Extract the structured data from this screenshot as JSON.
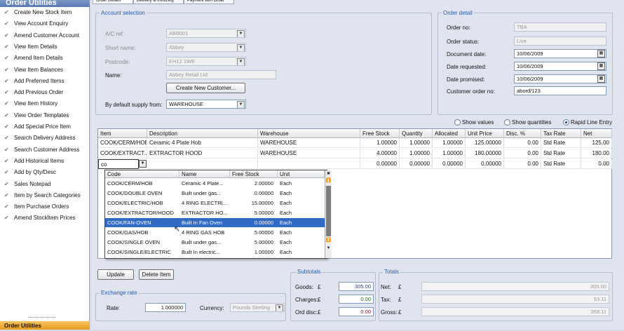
{
  "sidebar": {
    "title": "Order Utilities",
    "items": [
      "Create New Stock Item",
      "View Account Enquiry",
      "Amend Customer Account",
      "View Item Details",
      "Amend Item Details",
      "View Item Balances",
      "Add Preferred Items",
      "Add Previous Order",
      "View Item History",
      "View Order Templates",
      "Add Special Price Item",
      "Search Delivery Address",
      "Search Customer Address",
      "Add Historical Items",
      "Add by Qty/Desc",
      "Sales Notepad",
      "Item by Search Categories",
      "Item Purchase Orders",
      "Amend StockItem Prices"
    ],
    "footer": "Order Utilities"
  },
  "tabs": [
    "Order Details",
    "Delivery & Invoicing",
    "Payment with Order"
  ],
  "account": {
    "title": "Account selection",
    "ac_ref_label": "A/C ref:",
    "ac_ref": "ABB001",
    "short_name_label": "Short name:",
    "short_name": "Abbey",
    "postcode_label": "Postcode:",
    "postcode": "EH12 1WE",
    "name_label": "Name:",
    "name": "Abbey Retail Ltd",
    "create_button": "Create New Customer...",
    "supply_label": "By default supply from:",
    "supply": "WAREHOUSE"
  },
  "order": {
    "title": "Order detail",
    "order_no_label": "Order no:",
    "order_no": "TBA",
    "status_label": "Order status:",
    "status": "Live",
    "doc_date_label": "Document date:",
    "doc_date": "10/06/2009",
    "req_label": "Date requested:",
    "req_date": "10/06/2009",
    "prom_label": "Date promised:",
    "prom_date": "10/06/2009",
    "cust_order_label": "Customer order no:",
    "cust_order": "abord/123"
  },
  "radios": {
    "values": "Show values",
    "quantities": "Show quantities",
    "rapid": "Rapid Line Entry"
  },
  "grid": {
    "headers": [
      "Item",
      "Description",
      "Warehouse",
      "Free Stock",
      "Quantity",
      "Allocated",
      "Unit Price",
      "Disc. %",
      "Tax Rate",
      "Net"
    ],
    "rows": [
      [
        "COOK/CERM/HOB",
        "Ceramic 4 Plate Hob",
        "WAREHOUSE",
        "1.00000",
        "1.00000",
        "1.00000",
        "125.00000",
        "0.00",
        "Std Rate",
        "125.00"
      ],
      [
        "COOK/EXTRACT...",
        "EXTRACTOR HOOD",
        "WAREHOUSE",
        "4.00000",
        "1.00000",
        "1.00000",
        "180.00000",
        "0.00",
        "Std Rate",
        "180.00"
      ],
      [
        "co",
        "",
        "",
        "0.00000",
        "0.00000",
        "0.00000",
        "0.00000",
        "0.00",
        "Std Rate",
        "0.00"
      ]
    ]
  },
  "popup": {
    "headers": [
      "Code",
      "Name",
      "Free Stock",
      "Unit"
    ],
    "rows": [
      [
        "COOK/CERM/HOB",
        "Ceramic 4 Plate...",
        "2.00000",
        "Each"
      ],
      [
        "COOK/DOUBLE OVEN",
        "Built under gas...",
        "0.00000",
        "Each"
      ],
      [
        "COOK/ELECTRIC/HOB",
        "4 RING ELECTRI...",
        "15.00000",
        "Each"
      ],
      [
        "COOK/EXTRACTOR/HOOD",
        "EXTRACTOR HO...",
        "5.00000",
        "Each"
      ],
      [
        "COOK/FAN-OVEN",
        "Built In Fan Oven",
        "0.00000",
        "Each"
      ],
      [
        "COOK/GAS/HOB",
        "4 RING GAS HOB",
        "5.00000",
        "Each"
      ],
      [
        "COOK/SINGLE OVEN",
        "Built under gas...",
        "5.00000",
        "Each"
      ],
      [
        "COOK/SINGLE/ELECTRIC",
        "Built In electric...",
        "1.00000",
        "Each"
      ]
    ]
  },
  "buttons": {
    "update": "Update",
    "delete": "Delete Item"
  },
  "exchange": {
    "title": "Exchange rate",
    "rate_label": "Rate:",
    "rate": "1.000000",
    "currency_label": "Currency:",
    "currency": "Pounds Sterling"
  },
  "subtotals": {
    "title": "Subtotals",
    "goods_label": "Goods:",
    "goods": "305.00",
    "charges_label": "Charges:",
    "charges": "0.00",
    "orddisc_label": "Ord disc:",
    "orddisc": "0.00",
    "currency_symbol": "£"
  },
  "totals": {
    "title": "Totals",
    "net_label": "Net:",
    "net": "305.00",
    "tax_label": "Tax:",
    "tax": "53.11",
    "gross_label": "Gross:",
    "gross": "358.11",
    "currency_symbol": "£"
  }
}
